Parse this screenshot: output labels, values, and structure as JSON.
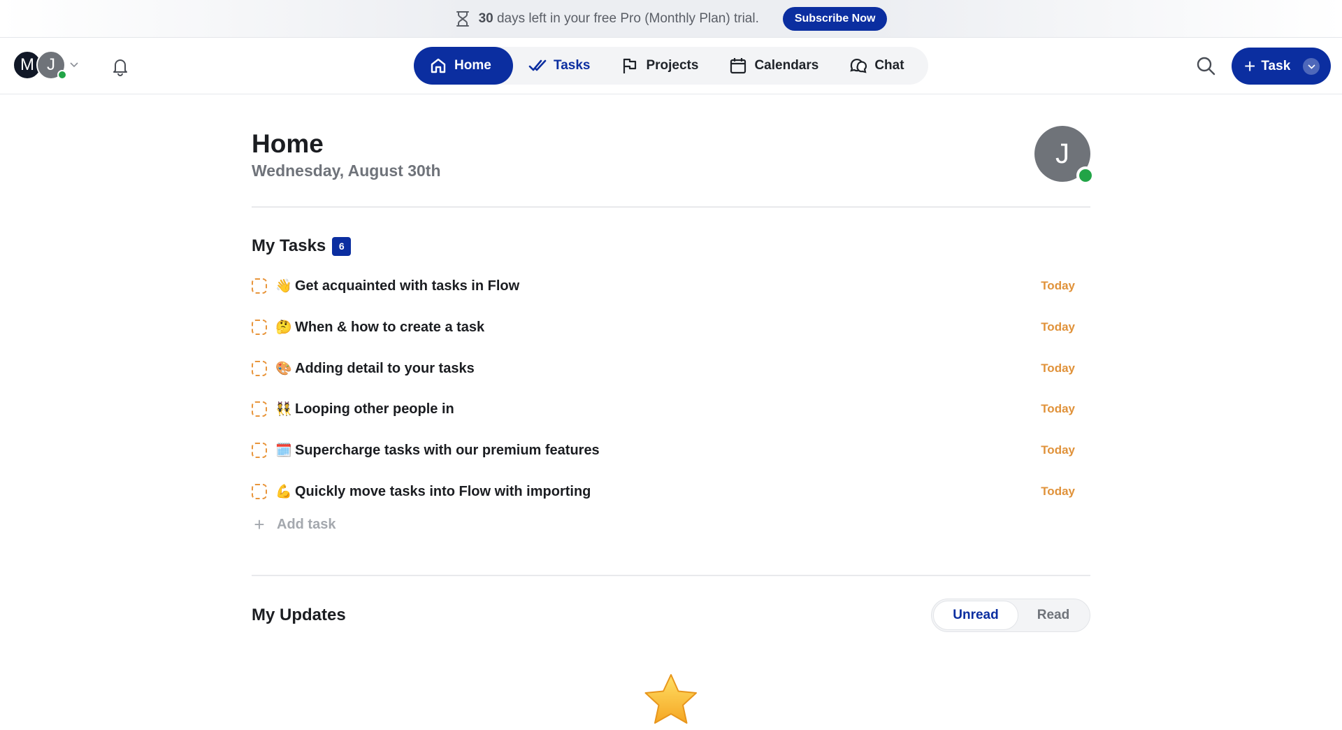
{
  "banner": {
    "days_bold": "30",
    "text": "days left in your free Pro (Monthly Plan) trial.",
    "subscribe_label": "Subscribe Now"
  },
  "topnav": {
    "avatar_initials": [
      "M",
      "J"
    ],
    "nav_items": [
      {
        "label": "Home",
        "icon": "home-icon",
        "active": true
      },
      {
        "label": "Tasks",
        "icon": "check-double-icon"
      },
      {
        "label": "Projects",
        "icon": "flag-icon"
      },
      {
        "label": "Calendars",
        "icon": "calendar-icon"
      },
      {
        "label": "Chat",
        "icon": "chat-icon"
      }
    ],
    "new_task_label": "Task"
  },
  "page": {
    "title": "Home",
    "date": "Wednesday, August 30th",
    "avatar_initial": "J"
  },
  "my_tasks": {
    "title": "My Tasks",
    "count": "6",
    "tasks": [
      {
        "emoji": "👋",
        "label": "Get acquainted with tasks in Flow",
        "due": "Today"
      },
      {
        "emoji": "🤔",
        "label": "When & how to create a task",
        "due": "Today"
      },
      {
        "emoji": "🎨",
        "label": "Adding detail to your tasks",
        "due": "Today"
      },
      {
        "emoji": "👯",
        "label": "Looping other people in",
        "due": "Today"
      },
      {
        "emoji": "🗓️",
        "label": "Supercharge tasks with our premium features",
        "due": "Today"
      },
      {
        "emoji": "💪",
        "label": "Quickly move tasks into Flow with importing",
        "due": "Today"
      }
    ],
    "add_task_label": "Add task"
  },
  "my_updates": {
    "title": "My Updates",
    "tabs": [
      "Unread",
      "Read"
    ],
    "selected_tab": "Unread"
  },
  "colors": {
    "brand": "#0b2ea0",
    "due_orange": "#e0923a",
    "online_green": "#22a447"
  }
}
